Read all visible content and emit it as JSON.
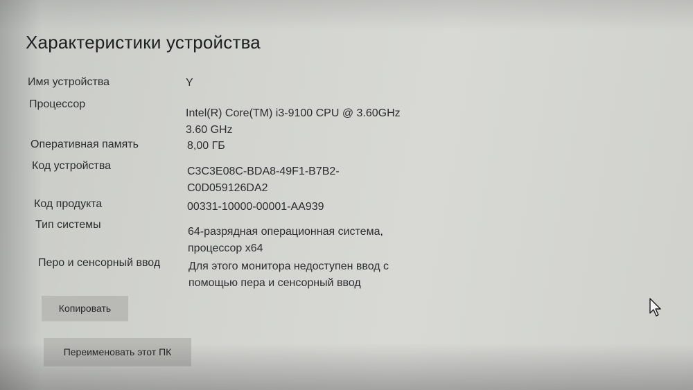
{
  "section": {
    "title": "Характеристики устройства"
  },
  "specs": [
    {
      "label": "Имя устройства",
      "value": [
        "Y"
      ]
    },
    {
      "label": "Процессор",
      "value": [
        "Intel(R) Core(TM) i3-9100 CPU @ 3.60GHz",
        "3.60 GHz"
      ]
    },
    {
      "label": "Оперативная память",
      "value": [
        "8,00 ГБ"
      ]
    },
    {
      "label": "Код устройства",
      "value": [
        "C3C3E08C-BDA8-49F1-B7B2-",
        "C0D059126DA2"
      ]
    },
    {
      "label": "Код продукта",
      "value": [
        "00331-10000-00001-AA939"
      ]
    },
    {
      "label": "Тип системы",
      "value": [
        "64-разрядная операционная система,",
        "процессор x64"
      ]
    },
    {
      "label": "Перо и сенсорный ввод",
      "value": [
        "Для этого монитора недоступен ввод с",
        "помощью пера и сенсорный ввод"
      ]
    }
  ],
  "buttons": {
    "copy_label": "Копировать",
    "rename_label": "Переименовать этот ПК"
  },
  "icons": {
    "cursor": "mouse-pointer-icon"
  }
}
